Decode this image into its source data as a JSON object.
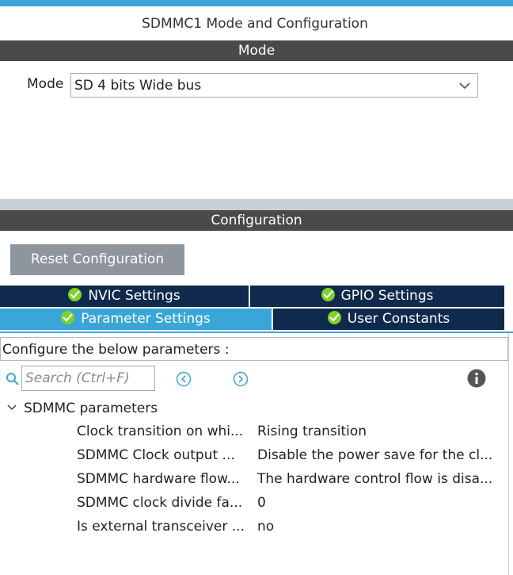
{
  "window": {
    "title": "SDMMC1 Mode and Configuration"
  },
  "mode_section": {
    "header": "Mode",
    "label": "Mode",
    "selected": "SD 4 bits Wide bus"
  },
  "config_section": {
    "header": "Configuration",
    "reset_label": "Reset Configuration"
  },
  "tabs": [
    {
      "label": "NVIC Settings",
      "active": false
    },
    {
      "label": "GPIO Settings",
      "active": false
    },
    {
      "label": "Parameter Settings",
      "active": true
    },
    {
      "label": "User Constants",
      "active": false
    }
  ],
  "panel": {
    "instruction": "Configure the below parameters :",
    "search_placeholder": "Search (Ctrl+F)",
    "group": "SDMMC parameters",
    "params": [
      {
        "name": "Clock transition on whi...",
        "value": "Rising transition"
      },
      {
        "name": "SDMMC Clock output ...",
        "value": "Disable the power save for the cl..."
      },
      {
        "name": "SDMMC hardware flow...",
        "value": "The hardware control flow is disa..."
      },
      {
        "name": "SDMMC clock divide fa...",
        "value": "0"
      },
      {
        "name": "Is external transceiver ...",
        "value": "no"
      }
    ]
  },
  "colors": {
    "accent": "#3aa6d8",
    "tab_dark": "#0f2a4d",
    "header_gray": "#4a4a4a",
    "check_green": "#7ed321"
  }
}
